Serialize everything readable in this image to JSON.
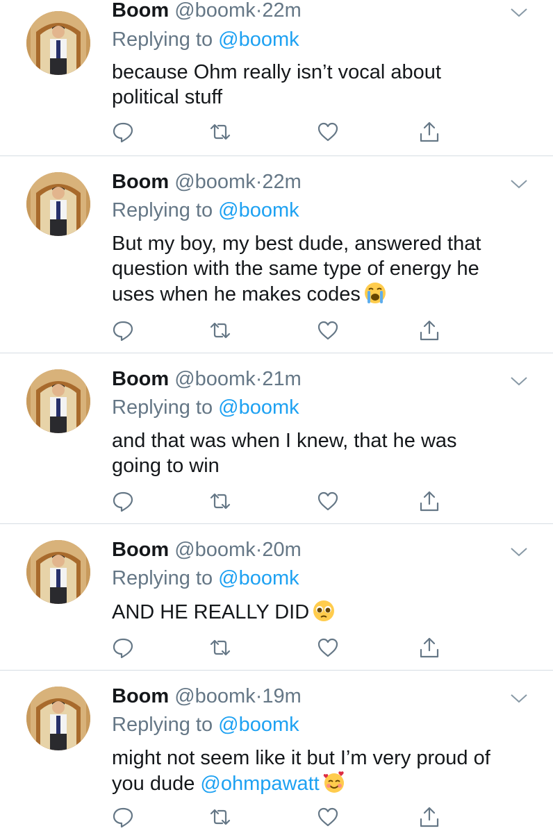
{
  "colors": {
    "accent": "#1da1f2",
    "muted": "#657786",
    "text": "#14171a",
    "divider": "#d6dde3"
  },
  "tweets": [
    {
      "name": "Boom",
      "handle": "@boomk",
      "sep": "·",
      "time": "22m",
      "replying_prefix": "Replying to",
      "replying_to": "@boomk",
      "lines": [
        "because Ohm really isn’t vocal about",
        "political stuff"
      ]
    },
    {
      "name": "Boom",
      "handle": "@boomk",
      "sep": "·",
      "time": "22m",
      "replying_prefix": "Replying to",
      "replying_to": "@boomk",
      "lines": [
        "But my boy, my best dude, answered that",
        "question with the same type of energy he",
        "uses when he makes codes"
      ],
      "emoji": "loudly-crying-face"
    },
    {
      "name": "Boom",
      "handle": "@boomk",
      "sep": "·",
      "time": "21m",
      "replying_prefix": "Replying to",
      "replying_to": "@boomk",
      "lines": [
        "and that was when I knew, that he was",
        "going to win"
      ]
    },
    {
      "name": "Boom",
      "handle": "@boomk",
      "sep": "·",
      "time": "20m",
      "replying_prefix": "Replying to",
      "replying_to": "@boomk",
      "lines": [
        "AND HE REALLY DID"
      ],
      "emoji": "pleading-face"
    },
    {
      "name": "Boom",
      "handle": "@boomk",
      "sep": "·",
      "time": "19m",
      "replying_prefix": "Replying to",
      "replying_to": "@boomk",
      "lines": [
        "might not seem like it but I’m very proud of",
        "you dude"
      ],
      "mention_end": "@ohmpawatt",
      "emoji": "smiling-face-with-hearts"
    }
  ],
  "action_icons": [
    "reply-icon",
    "retweet-icon",
    "like-icon",
    "share-icon"
  ]
}
